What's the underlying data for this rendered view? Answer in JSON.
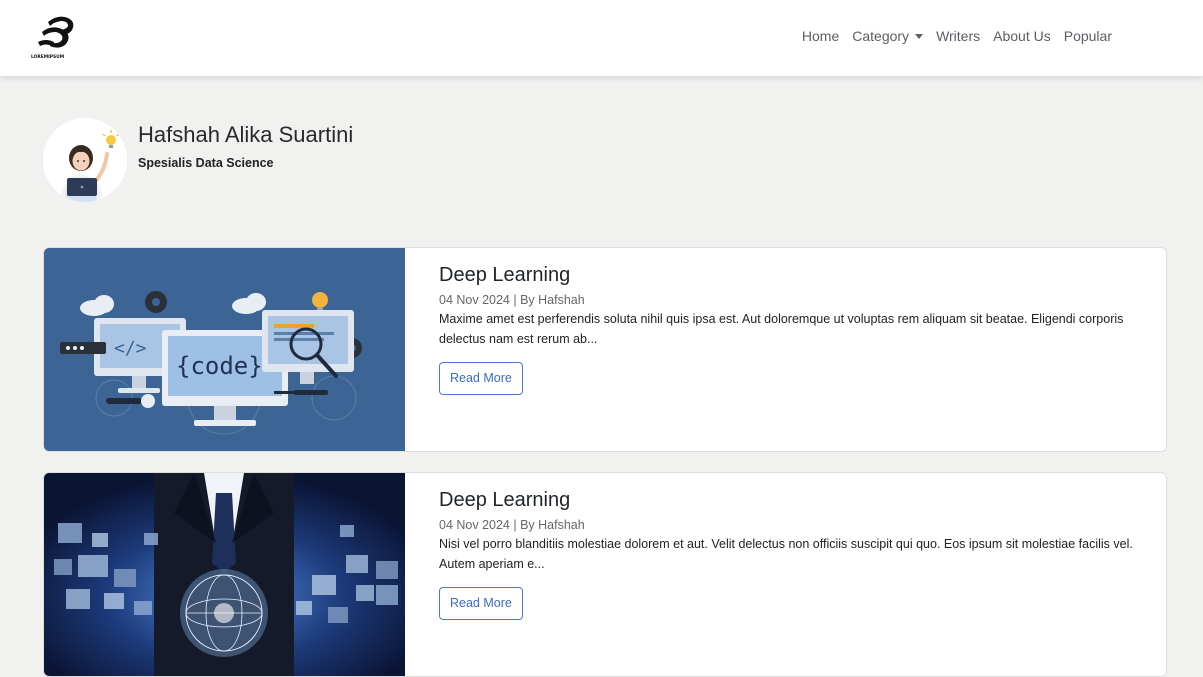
{
  "navbar": {
    "brand_text": "LOREMIPSUM",
    "links": [
      "Home",
      "Category",
      "Writers",
      "About Us",
      "Popular"
    ]
  },
  "profile": {
    "name": "Hafshah Alika Suartini",
    "role": "Spesialis Data Science"
  },
  "posts": [
    {
      "title": "Deep Learning",
      "meta": "04 Nov 2024 | By Hafshah",
      "excerpt": "Maxime amet est perferendis soluta nihil quis ipsa est. Aut doloremque ut voluptas rem aliquam sit beatae. Eligendi corporis delectus nam est rerum ab...",
      "button": "Read More",
      "image_code_text": "{code}",
      "image_tag_text": "</>"
    },
    {
      "title": "Deep Learning",
      "meta": "04 Nov 2024 | By Hafshah",
      "excerpt": "Nisi vel porro blanditiis molestiae dolorem et aut. Velit delectus non officiis suscipit qui quo. Eos ipsum sit molestiae facilis vel. Autem aperiam e...",
      "button": "Read More"
    }
  ],
  "colors": {
    "accent": "#3a6bc9",
    "page_bg": "#f1f1f0",
    "card1_image_bg": "#3c6595",
    "card2_image_bg": "#0c1a44"
  }
}
